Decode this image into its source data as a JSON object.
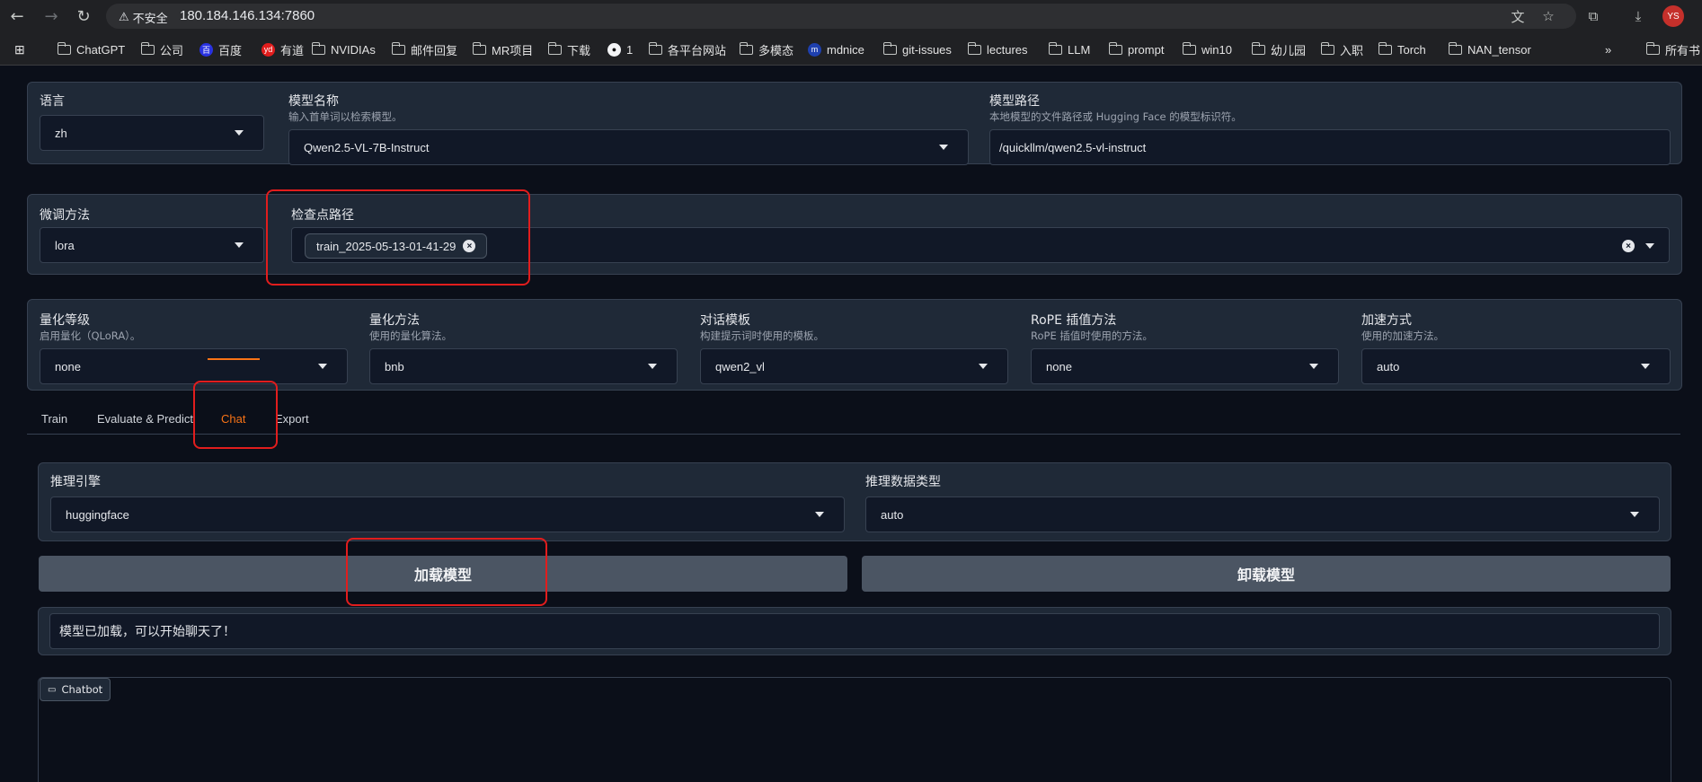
{
  "browser": {
    "security_label": "不安全",
    "url": "180.184.146.134:7860",
    "avatar_initials": "YS",
    "bookmarks": [
      {
        "label": "ChatGPT",
        "icon": "folder-icon"
      },
      {
        "label": "公司",
        "icon": "folder-icon"
      },
      {
        "label": "百度",
        "icon": "baidu-icon"
      },
      {
        "label": "有道",
        "icon": "youdao-icon"
      },
      {
        "label": "NVIDIAs",
        "icon": "folder-icon"
      },
      {
        "label": "邮件回复",
        "icon": "folder-icon"
      },
      {
        "label": "MR项目",
        "icon": "folder-icon"
      },
      {
        "label": "下载",
        "icon": "folder-icon"
      },
      {
        "label": "1",
        "icon": "github-icon"
      },
      {
        "label": "各平台网站",
        "icon": "folder-icon"
      },
      {
        "label": "多模态",
        "icon": "folder-icon"
      },
      {
        "label": "mdnice",
        "icon": "mdnice-icon"
      },
      {
        "label": "git-issues",
        "icon": "folder-icon"
      },
      {
        "label": "lectures",
        "icon": "folder-icon"
      },
      {
        "label": "LLM",
        "icon": "folder-icon"
      },
      {
        "label": "prompt",
        "icon": "folder-icon"
      },
      {
        "label": "win10",
        "icon": "folder-icon"
      },
      {
        "label": "幼儿园",
        "icon": "folder-icon"
      },
      {
        "label": "入职",
        "icon": "folder-icon"
      },
      {
        "label": "Torch",
        "icon": "folder-icon"
      },
      {
        "label": "NAN_tensor",
        "icon": "folder-icon"
      }
    ],
    "more_label": "»",
    "all_bookmarks_label": "所有书"
  },
  "model_row": {
    "lang": {
      "label": "语言",
      "value": "zh"
    },
    "model_name": {
      "label": "模型名称",
      "desc": "输入首单词以检索模型。",
      "value": "Qwen2.5-VL-7B-Instruct"
    },
    "model_path": {
      "label": "模型路径",
      "desc": "本地模型的文件路径或 Hugging Face 的模型标识符。",
      "value": "/quickllm/qwen2.5-vl-instruct"
    }
  },
  "finetune_row": {
    "method": {
      "label": "微调方法",
      "value": "lora"
    },
    "checkpoint": {
      "label": "检查点路径",
      "chip": "train_2025-05-13-01-41-29"
    }
  },
  "quant_row": {
    "level": {
      "label": "量化等级",
      "desc": "启用量化（QLoRA）。",
      "value": "none"
    },
    "method": {
      "label": "量化方法",
      "desc": "使用的量化算法。",
      "value": "bnb"
    },
    "template": {
      "label": "对话模板",
      "desc": "构建提示词时使用的模板。",
      "value": "qwen2_vl"
    },
    "rope": {
      "label": "RoPE 插值方法",
      "desc": "RoPE 插值时使用的方法。",
      "value": "none"
    },
    "accel": {
      "label": "加速方式",
      "desc": "使用的加速方法。",
      "value": "auto"
    }
  },
  "tabs": [
    "Train",
    "Evaluate & Predict",
    "Chat",
    "Export"
  ],
  "active_tab": "Chat",
  "chat": {
    "engine": {
      "label": "推理引擎",
      "value": "huggingface"
    },
    "dtype": {
      "label": "推理数据类型",
      "value": "auto"
    },
    "load_button": "加载模型",
    "unload_button": "卸载模型",
    "status": "模型已加载，可以开始聊天了！",
    "chatbot_label": "Chatbot"
  },
  "colors": {
    "accent": "#f97316",
    "highlight": "#e11d1d",
    "panel": "#1f2937",
    "background": "#0b0f19"
  }
}
